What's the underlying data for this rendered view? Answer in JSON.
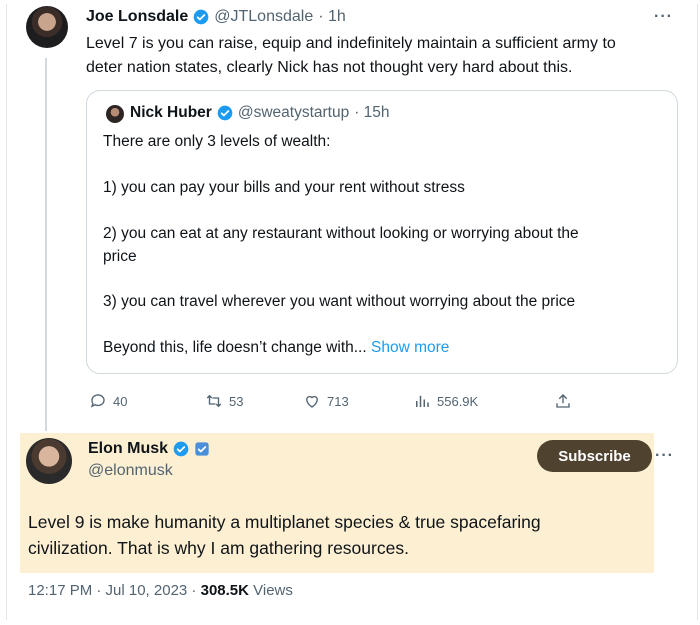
{
  "reply_tweet": {
    "author_name": "Joe Lonsdale",
    "author_handle": "@JTLonsdale",
    "time": "· 1h",
    "more": "···",
    "lines": [
      "Level 7 is you can raise, equip and indefinitely maintain a sufficient army to",
      "deter nation states, clearly Nick has not thought very hard about this."
    ]
  },
  "quoted_tweet": {
    "author_name": "Nick Huber",
    "author_handle": "@sweatystartup",
    "time": "· 15h",
    "lines": [
      "There are only 3 levels of wealth:",
      "1) you can pay your bills and your rent without stress",
      "2) you can eat at any restaurant without looking or worrying about the",
      "price",
      "3) you can travel wherever you want without worrying about the price",
      "Beyond this, life doesn’t change with..."
    ],
    "show_more": "Show more"
  },
  "actions": {
    "replies": "40",
    "reposts": "53",
    "likes": "713",
    "views": "556.9K"
  },
  "main_tweet": {
    "author_name": "Elon Musk",
    "author_handle": "@elonmusk",
    "subscribe_label": "Subscribe",
    "more": "···",
    "lines": [
      "Level 9 is make humanity a multiplanet species & true spacefaring",
      "civilization. That is why I am gathering resources."
    ],
    "highlight_color": "#fdf0d2"
  },
  "footer": {
    "time": "12:17 PM · Jul 10, 2023 · ",
    "views_count": "308.5K",
    "views_label": " Views"
  }
}
